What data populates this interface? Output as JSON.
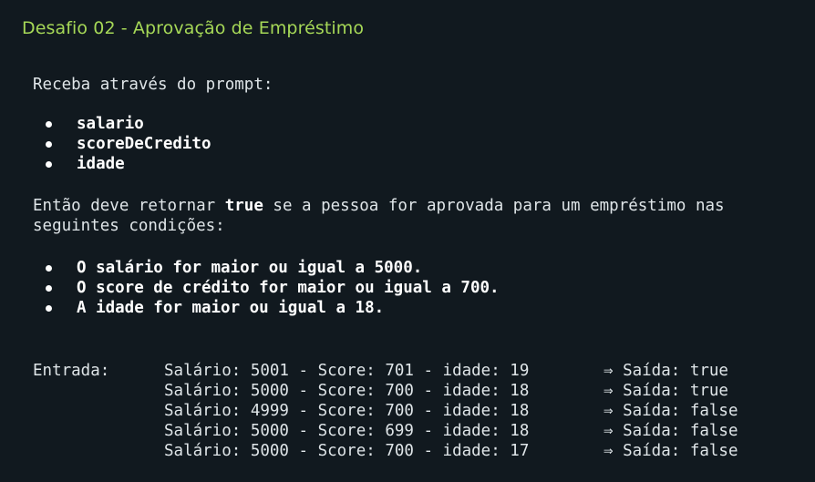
{
  "title": "Desafio 02 - Aprovação de Empréstimo",
  "intro": "Receba através do prompt:",
  "inputs": [
    "salario",
    "scoreDeCredito",
    "idade"
  ],
  "condition_text": {
    "prefix": "Então deve retornar ",
    "bold": "true",
    "suffix": " se a pessoa for aprovada para um empréstimo nas",
    "line2": "seguintes condições:"
  },
  "conditions": [
    "O salário for maior ou igual a 5000.",
    "O score de crédito for maior ou igual a 700.",
    "A idade for maior ou igual a 18."
  ],
  "examples": {
    "label": "Entrada:",
    "rows": [
      {
        "input": "Salário: 5001 - Score: 701 - idade: 19",
        "output": "⇒ Saída: true"
      },
      {
        "input": "Salário: 5000 - Score: 700 - idade: 18",
        "output": "⇒ Saída: true"
      },
      {
        "input": "Salário: 4999 - Score: 700 - idade: 18",
        "output": "⇒ Saída: false"
      },
      {
        "input": "Salário: 5000 - Score: 699 - idade: 18",
        "output": "⇒ Saída: false"
      },
      {
        "input": "Salário: 5000 - Score: 700 - idade: 17",
        "output": "⇒ Saída: false"
      }
    ]
  },
  "colors": {
    "background": "#11191f",
    "title": "#a6d857",
    "text": "#dfe5e8"
  }
}
